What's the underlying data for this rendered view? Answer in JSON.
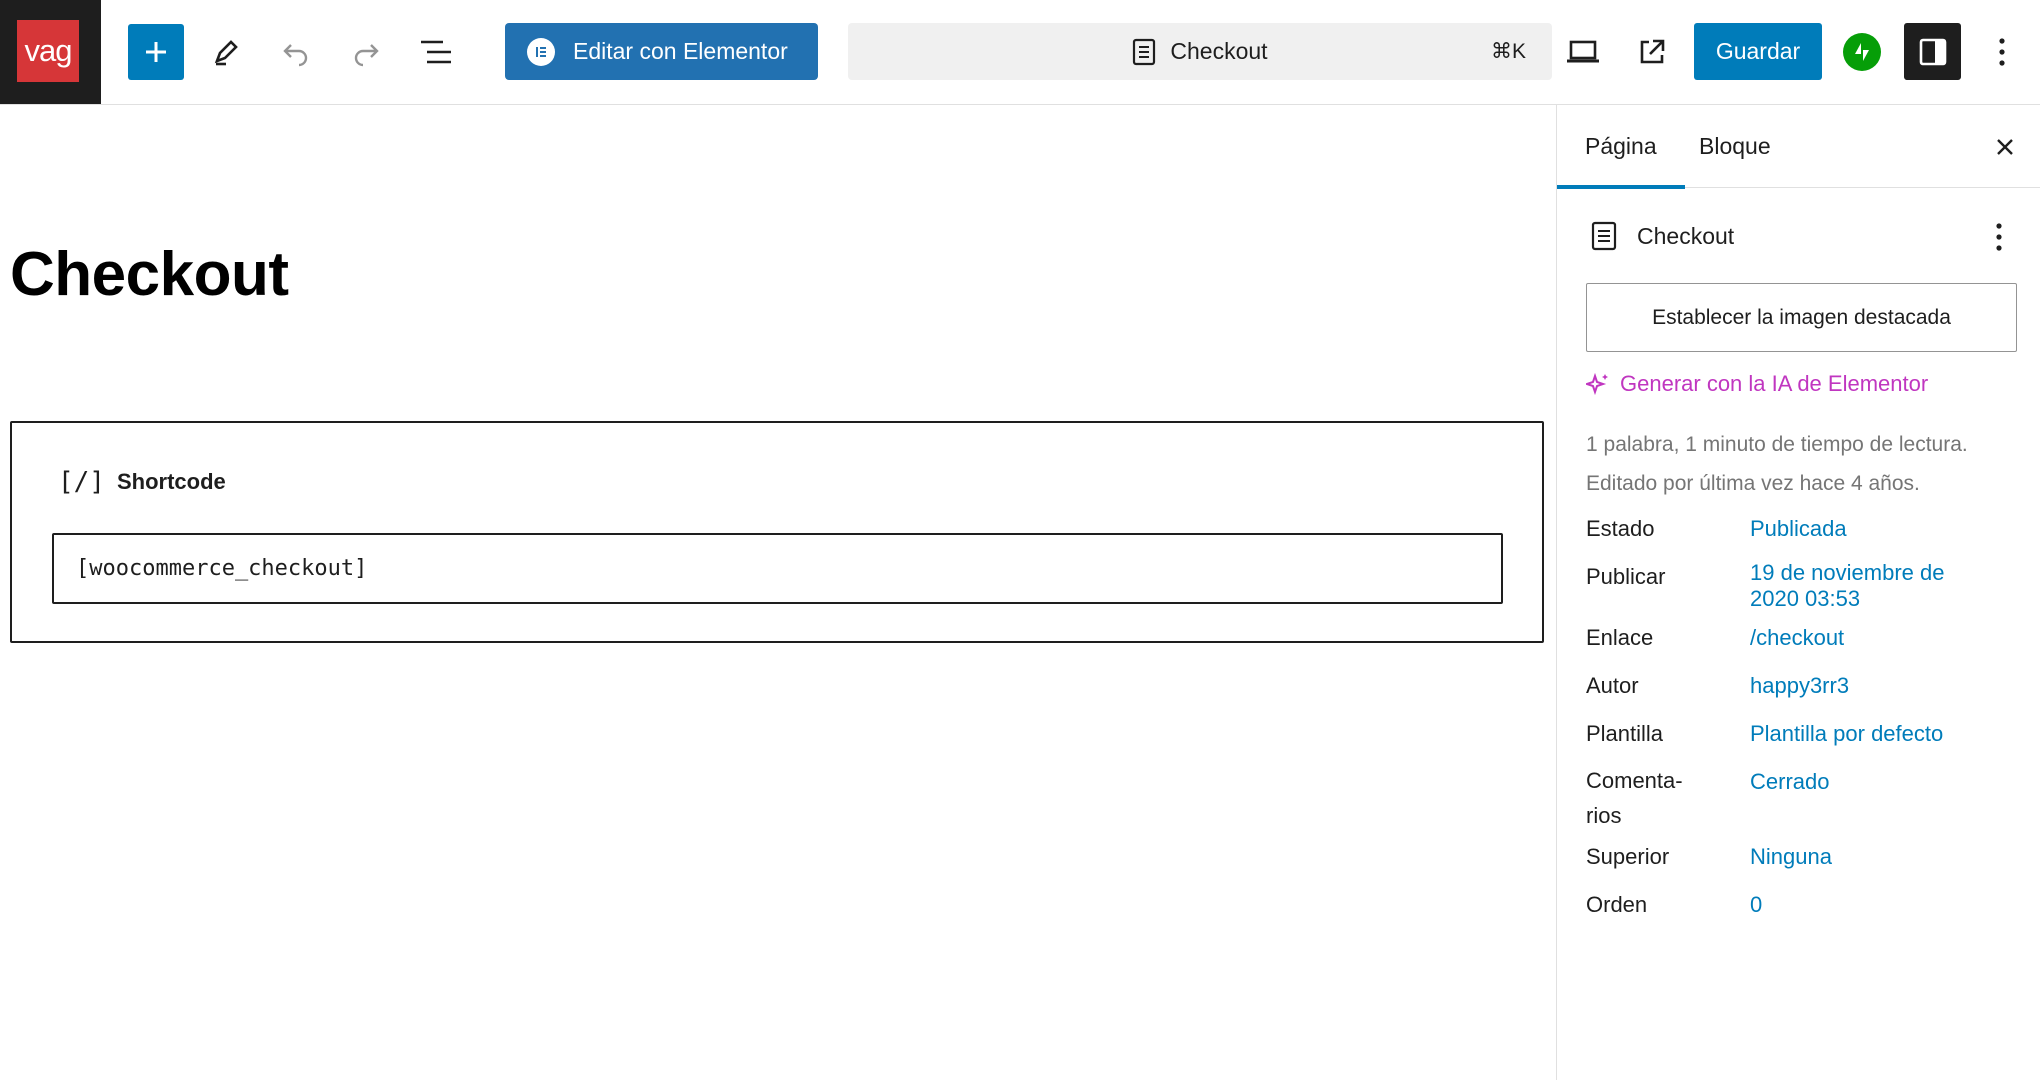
{
  "site": {
    "logo_text": "vag",
    "logo_color": "#d63638"
  },
  "toolbar": {
    "inserter_icon": "plus-icon",
    "tools_icon": "pencil-icon",
    "undo_icon": "undo-icon",
    "redo_icon": "redo-icon",
    "outline_icon": "list-view-icon",
    "elementor_label": "Editar con Elementor",
    "command_title": "Checkout",
    "command_shortcut": "⌘K",
    "device_icon": "laptop-icon",
    "view_icon": "external-link-icon",
    "save_label": "Guardar",
    "jetpack_icon": "jetpack-icon",
    "settings_icon": "sidebar-toggle-icon",
    "more_icon": "more-vertical-icon",
    "accent": "#007cba",
    "elementor_color": "#2271b1"
  },
  "editor": {
    "title": "Checkout",
    "shortcode_block": {
      "icon_text": "[/]",
      "label": "Shortcode",
      "value": "[woocommerce_checkout]"
    }
  },
  "sidebar": {
    "tabs": [
      {
        "label": "Página",
        "active": true
      },
      {
        "label": "Bloque",
        "active": false
      }
    ],
    "doc_title": "Checkout",
    "featured_image_button": "Establecer la imagen destacada",
    "ai_link": "Generar con la IA de Elementor",
    "ai_color": "#c036c0",
    "meta_line1": "1 palabra, 1 minuto de tiempo de lectura.",
    "meta_line2": "Editado por última vez hace 4 años.",
    "props": [
      {
        "label": "Estado",
        "value": "Publicada"
      },
      {
        "label": "Publicar",
        "value": "19 de noviembre de 2020 03:53"
      },
      {
        "label": "Enlace",
        "value": "/checkout"
      },
      {
        "label": "Autor",
        "value": "happy3rr3"
      },
      {
        "label": "Plantilla",
        "value": "Plantilla por defecto"
      },
      {
        "label": "Comenta-\nrios",
        "value": "Cerrado"
      },
      {
        "label": "Superior",
        "value": "Ninguna"
      },
      {
        "label": "Orden",
        "value": "0"
      }
    ]
  }
}
